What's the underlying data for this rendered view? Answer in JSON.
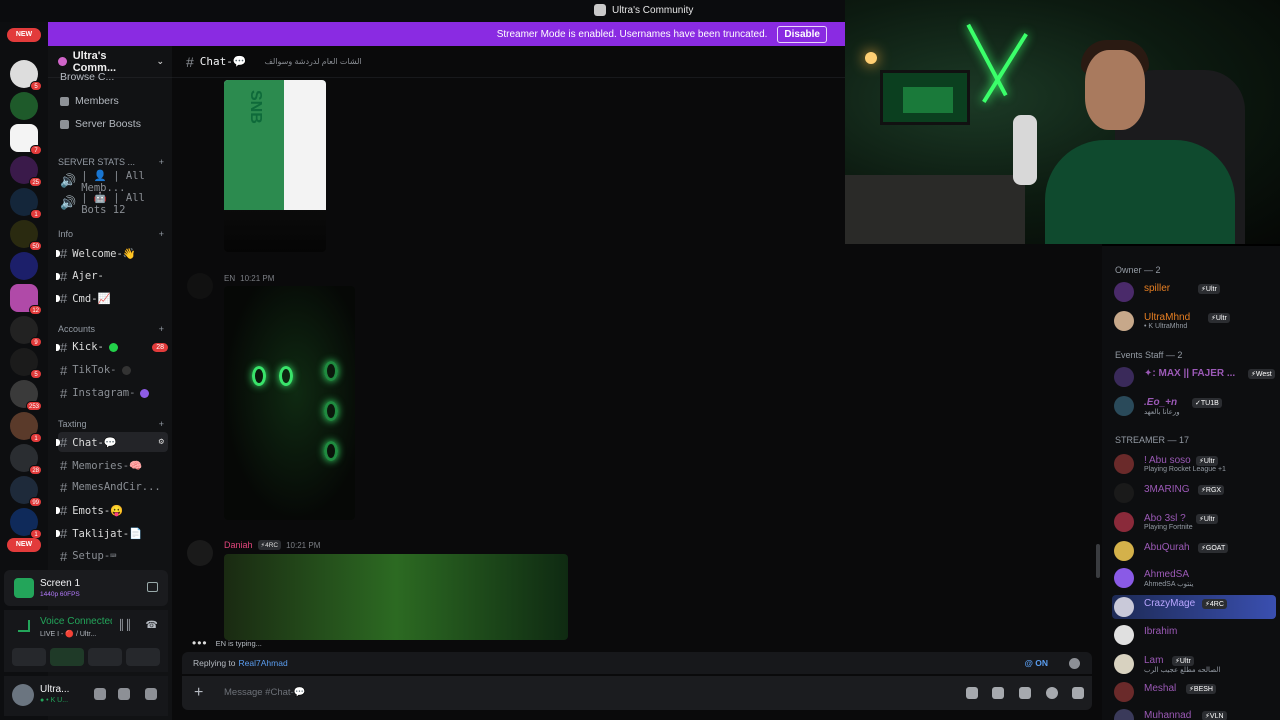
{
  "window": {
    "title": "Ultra's Community"
  },
  "banner": {
    "text": "Streamer Mode is enabled. Usernames have been truncated.",
    "button": "Disable"
  },
  "rail": {
    "new_top": "NEW",
    "new_bottom": "NEW",
    "badges": [
      "5",
      "7",
      "25",
      "1",
      "50",
      "12",
      "9",
      "5",
      "253",
      "1",
      "28",
      "99",
      "1"
    ]
  },
  "server": {
    "name": "Ultra's Comm...",
    "menu": [
      "Browse C...",
      "Members",
      "Server Boosts"
    ]
  },
  "categories": {
    "stats": "SERVER STATS ...",
    "info": "Info",
    "accounts": "Accounts",
    "texting": "Taxting"
  },
  "stats_channels": [
    "| 👤 | All Memb...",
    "| 🤖 | All Bots 12"
  ],
  "channels": {
    "welcome": "Welcome-👋",
    "ajer": "Ajer-",
    "cmd": "Cmd-📈",
    "kick": "Kick-",
    "kick_count": "28",
    "tiktok": "TikTok-",
    "instagram": "Instagram-",
    "chat": "Chat-💬",
    "memories": "Memories-🧠",
    "memes": "MemesAndCir...",
    "emots": "Emots-😛",
    "taklijat": "Taklijat-📄",
    "setup": "Setup-⌨"
  },
  "screen_panel": {
    "title": "Screen 1",
    "quality": "1440p 60FPS"
  },
  "voice_panel": {
    "status": "Voice Connected",
    "detail": "LIVE I - 🔴 / Ultr..."
  },
  "user_panel": {
    "name": "Ultra...",
    "status": "● • K U..."
  },
  "chat": {
    "channel": "Chat-💬",
    "topic": "الشات العام لدردشة وسوالف",
    "msg1_author": "EN",
    "msg1_time": "10:21 PM",
    "msg2_author": "Daniah",
    "msg2_tag": "⚡4RC",
    "msg2_time": "10:21 PM",
    "card_text": "SNB",
    "typing": "EN is typing...",
    "replying_label": "Replying to",
    "replying_to": "Real7Ahmad",
    "mention_toggle": "@ ON",
    "placeholder": "Message #Chat-💬"
  },
  "members": {
    "groups": [
      "Owner — 2",
      "Events Staff — 2",
      "STREAMER — 17"
    ],
    "list": [
      {
        "name": "spiller",
        "tag": "⚡Ultr",
        "sub": "",
        "color": "#e67e22"
      },
      {
        "name": "UltraMhnd",
        "tag": "⚡Ultr",
        "sub": "• K UltraMhnd",
        "color": "#e67e22"
      },
      {
        "name": "✦: MAX || FAJER ...",
        "tag": "⚡West",
        "sub": "",
        "color": "#9b59b6"
      },
      {
        "name": ".Eo_+n",
        "tag": "✓TU1B",
        "sub": "ورعانا بالعهد",
        "color": "#9b59b6"
      },
      {
        "name": "! Abu soso",
        "tag": "⚡Ultr",
        "sub": "Playing Rocket League +1",
        "color": "#9b59b6"
      },
      {
        "name": "3MARING",
        "tag": "⚡RGX",
        "sub": "",
        "color": "#9b59b6"
      },
      {
        "name": "Abo 3sl ?",
        "tag": "⚡Ultr",
        "sub": "Playing Fortnite",
        "color": "#9b59b6"
      },
      {
        "name": "AbuQurah",
        "tag": "⚡GOAT",
        "sub": "",
        "color": "#9b59b6"
      },
      {
        "name": "AhmedSA",
        "tag": "",
        "sub": "AhmedSA ينتوب",
        "color": "#9b59b6"
      },
      {
        "name": "CrazyMage",
        "tag": "⚡4RC",
        "sub": "",
        "color": "#9b59b6"
      },
      {
        "name": "Ibrahim",
        "tag": "",
        "sub": "",
        "color": "#9b59b6"
      },
      {
        "name": "Lam",
        "tag": "⚡Ultr",
        "sub": "الصالحه مطلع عجيب الرب",
        "color": "#9b59b6"
      },
      {
        "name": "Meshal",
        "tag": "⚡BESH",
        "sub": "",
        "color": "#9b59b6"
      },
      {
        "name": "Muhannad",
        "tag": "⚡VLN",
        "sub": "",
        "color": "#9b59b6"
      }
    ]
  }
}
